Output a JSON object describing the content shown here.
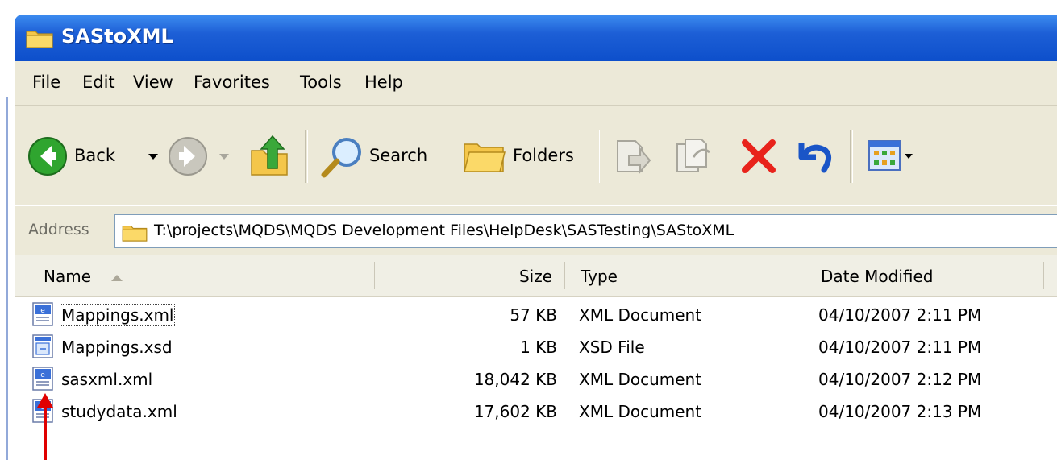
{
  "window": {
    "title": "SAStoXML"
  },
  "menu": [
    "File",
    "Edit",
    "View",
    "Favorites",
    "Tools",
    "Help"
  ],
  "toolbar": {
    "back_label": "Back",
    "search_label": "Search",
    "folders_label": "Folders"
  },
  "address": {
    "label": "Address",
    "value": "T:\\projects\\MQDS\\MQDS Development Files\\HelpDesk\\SASTesting\\SAStoXML"
  },
  "columns": {
    "name": "Name",
    "size": "Size",
    "type": "Type",
    "date": "Date Modified"
  },
  "files": [
    {
      "name": "Mappings.xml",
      "size": "57 KB",
      "type": "XML Document",
      "date": "04/10/2007 2:11 PM",
      "icon": "xml-file-icon"
    },
    {
      "name": "Mappings.xsd",
      "size": "1 KB",
      "type": "XSD File",
      "date": "04/10/2007 2:11 PM",
      "icon": "xsd-file-icon"
    },
    {
      "name": "sasxml.xml",
      "size": "18,042 KB",
      "type": "XML Document",
      "date": "04/10/2007 2:12 PM",
      "icon": "xml-file-icon"
    },
    {
      "name": "studydata.xml",
      "size": "17,602 KB",
      "type": "XML Document",
      "date": "04/10/2007 2:13 PM",
      "icon": "xml-file-icon"
    }
  ],
  "colors": {
    "titlebar": "#0d4fcb",
    "chrome": "#ece9d8",
    "delete_red": "#e8231b",
    "arrow_red": "#e00000"
  }
}
